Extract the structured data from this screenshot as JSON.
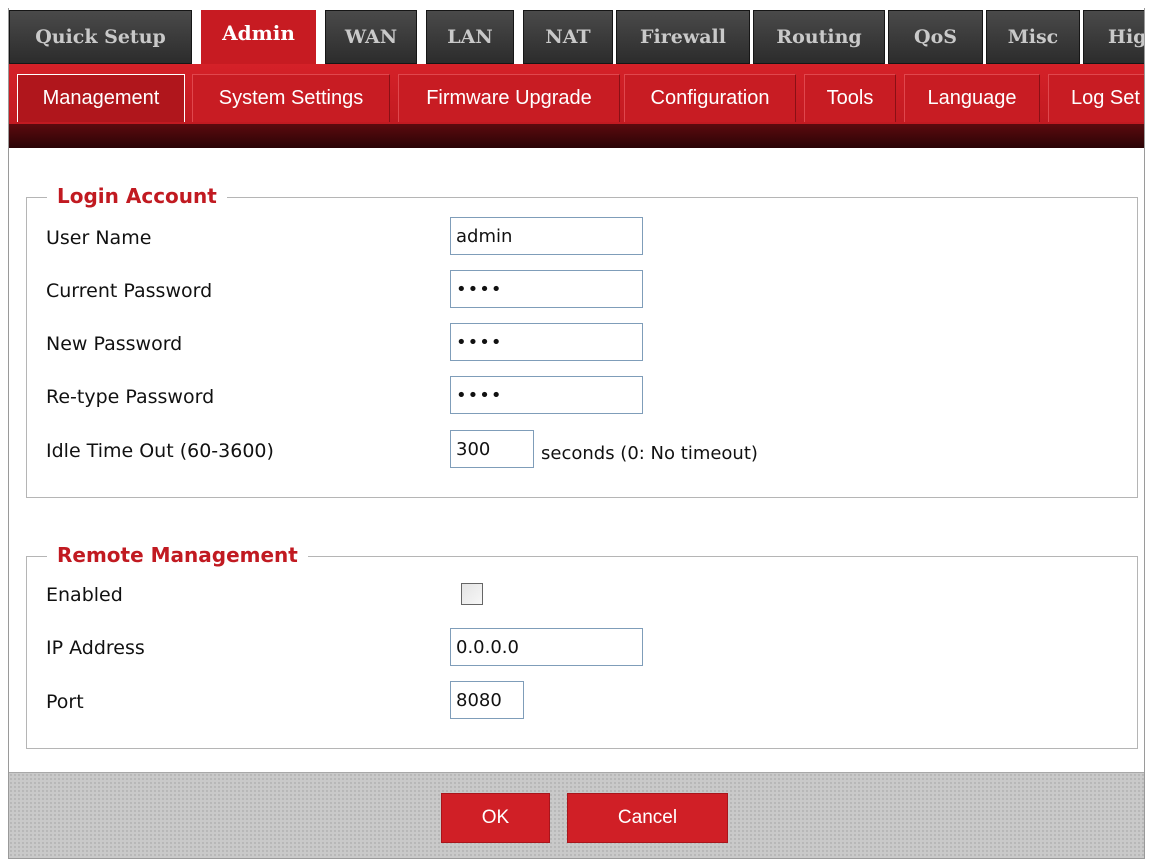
{
  "top_tabs": [
    "Quick Setup",
    "Admin",
    "WAN",
    "LAN",
    "NAT",
    "Firewall",
    "Routing",
    "QoS",
    "Misc",
    "Hig"
  ],
  "active_top_tab": "Admin",
  "sub_tabs": [
    "Management",
    "System Settings",
    "Firmware Upgrade",
    "Configuration",
    "Tools",
    "Language",
    "Log Set"
  ],
  "active_sub_tab": "Management",
  "login_account": {
    "legend": "Login Account",
    "user_name_label": "User Name",
    "user_name_value": "admin",
    "current_password_label": "Current Password",
    "current_password_value": "••••",
    "new_password_label": "New Password",
    "new_password_value": "••••",
    "retype_password_label": "Re-type Password",
    "retype_password_value": "••••",
    "idle_timeout_label": "Idle Time Out (60-3600)",
    "idle_timeout_value": "300",
    "idle_timeout_suffix": "seconds (0: No timeout)"
  },
  "remote_management": {
    "legend": "Remote Management",
    "enabled_label": "Enabled",
    "enabled_checked": false,
    "ip_address_label": "IP Address",
    "ip_address_value": "0.0.0.0",
    "port_label": "Port",
    "port_value": "8080"
  },
  "buttons": {
    "ok": "OK",
    "cancel": "Cancel"
  },
  "colors": {
    "brand_red": "#c71b22",
    "legend_red": "#c11a21",
    "dark_tab": "#2c2c2c"
  }
}
